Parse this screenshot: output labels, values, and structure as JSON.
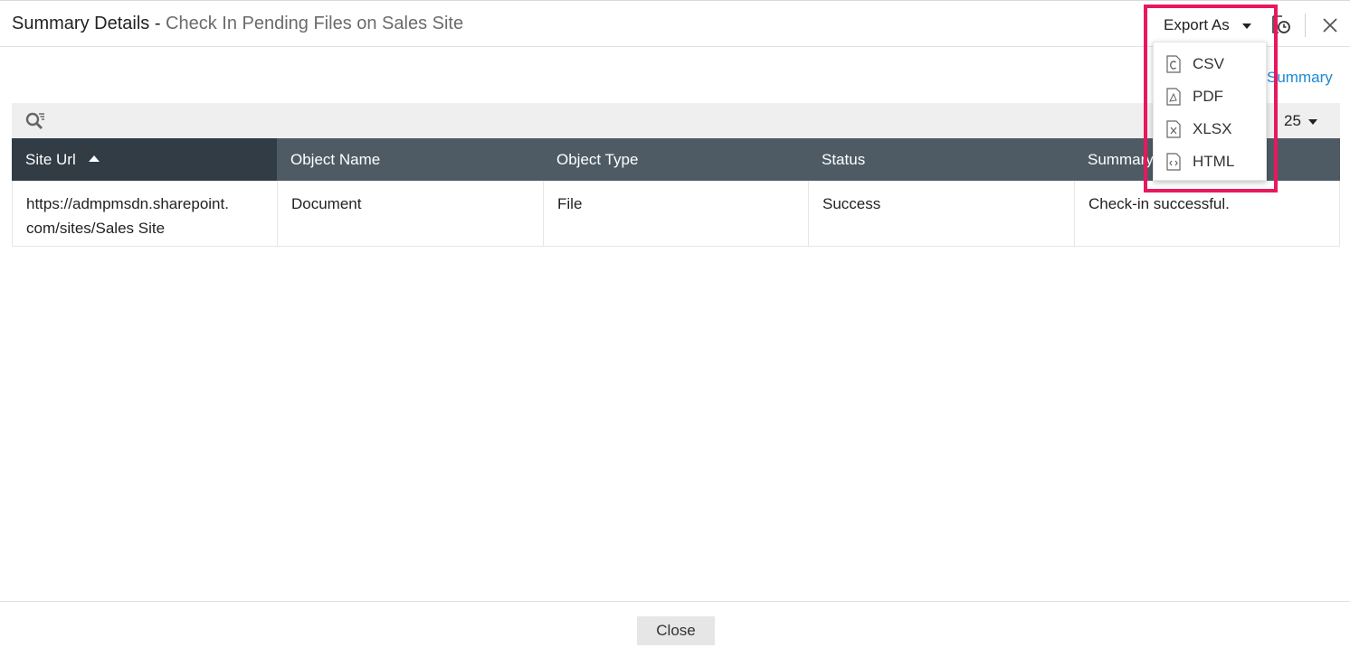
{
  "dialog": {
    "title_main": "Summary Details - ",
    "title_sub": "Check In Pending Files on Sales Site"
  },
  "header": {
    "export_label": "Export As"
  },
  "summary_link": "Summary",
  "toolbar": {
    "page_size": "25"
  },
  "table": {
    "columns": [
      "Site Url",
      "Object Name",
      "Object Type",
      "Status",
      "Summary"
    ],
    "sorted_column": "Site Url",
    "sort_direction": "ascending",
    "rows": [
      {
        "site_url_line1": "https://admpmsdn.sharepoint.",
        "site_url_line2": "com/sites/Sales Site",
        "object_name": "Document",
        "object_type": "File",
        "status": "Success",
        "summary": "Check-in successful."
      }
    ]
  },
  "export_menu": {
    "items": [
      {
        "label": "CSV",
        "icon": "csv-file-icon"
      },
      {
        "label": "PDF",
        "icon": "pdf-file-icon"
      },
      {
        "label": "XLSX",
        "icon": "xlsx-file-icon"
      },
      {
        "label": "HTML",
        "icon": "html-file-icon"
      }
    ]
  },
  "footer": {
    "close_label": "Close"
  },
  "colors": {
    "header_bg": "#4e5b65",
    "sorted_header_bg": "#313c45",
    "link": "#1a8ad4",
    "highlight": "#e8185d"
  }
}
